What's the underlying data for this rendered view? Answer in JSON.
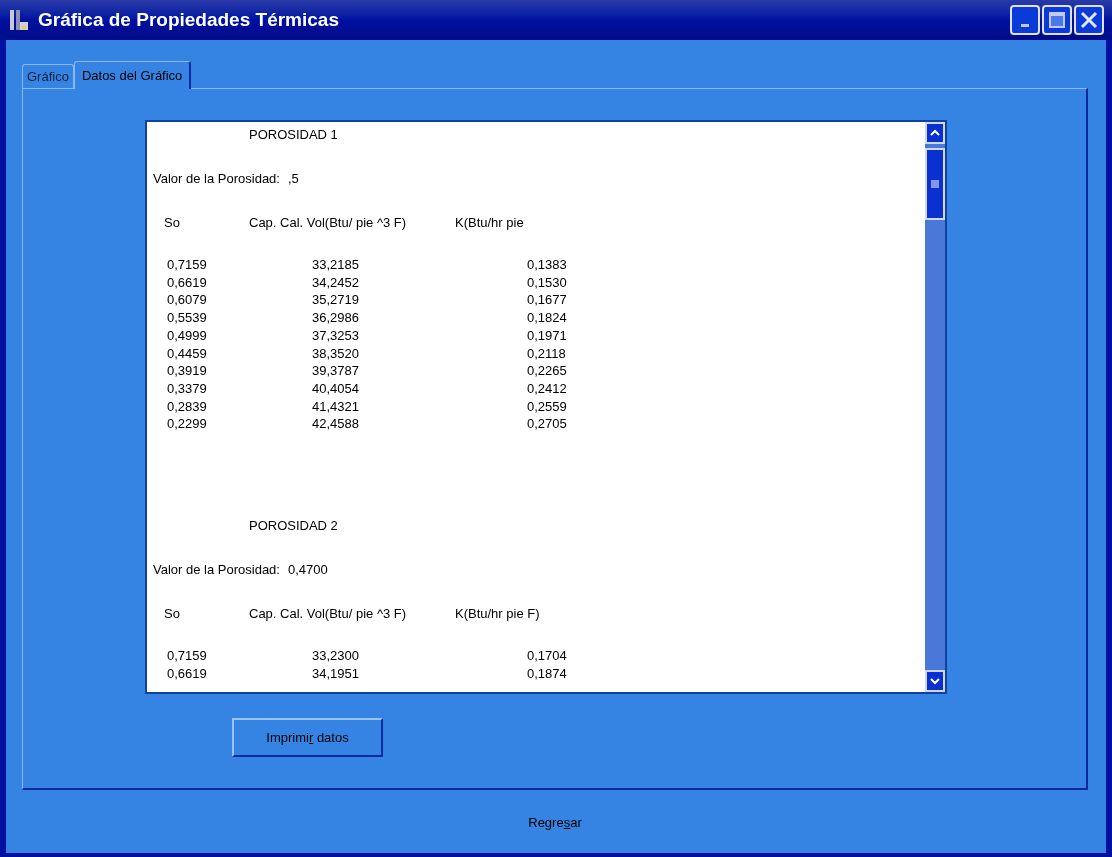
{
  "window": {
    "title": "Gráfica de Propiedades Térmicas"
  },
  "tabs": [
    {
      "label": "Gráfico",
      "selected": false
    },
    {
      "label": "Datos del Gráfico",
      "selected": true
    }
  ],
  "sections": [
    {
      "title": "POROSIDAD 1",
      "value_label": "Valor de la Porosidad:",
      "value": ",5",
      "columns": [
        "So",
        "Cap. Cal. Vol(Btu/ pie ^3 F)",
        "K(Btu/hr pie"
      ],
      "rows": [
        [
          "0,7159",
          "33,2185",
          "0,1383"
        ],
        [
          "0,6619",
          "34,2452",
          "0,1530"
        ],
        [
          "0,6079",
          "35,2719",
          "0,1677"
        ],
        [
          "0,5539",
          "36,2986",
          "0,1824"
        ],
        [
          "0,4999",
          "37,3253",
          "0,1971"
        ],
        [
          "0,4459",
          "38,3520",
          "0,2118"
        ],
        [
          "0,3919",
          "39,3787",
          "0,2265"
        ],
        [
          "0,3379",
          "40,4054",
          "0,2412"
        ],
        [
          "0,2839",
          "41,4321",
          "0,2559"
        ],
        [
          "0,2299",
          "42,4588",
          "0,2705"
        ]
      ]
    },
    {
      "title": "POROSIDAD 2",
      "value_label": "Valor de la Porosidad:",
      "value": "0,4700",
      "columns": [
        "So",
        "Cap. Cal. Vol(Btu/ pie ^3 F)",
        "K(Btu/hr pie F)"
      ],
      "rows": [
        [
          "0,7159",
          "33,2300",
          "0,1704"
        ],
        [
          "0,6619",
          "34,1951",
          "0,1874"
        ]
      ]
    }
  ],
  "print_button": {
    "label_parts": [
      {
        "text": "Imprimi",
        "underline": false
      },
      {
        "text": "r",
        "underline": true
      },
      {
        "text": " datos",
        "underline": false
      }
    ]
  },
  "back_button": {
    "label_parts": [
      {
        "text": "Regre",
        "underline": false
      },
      {
        "text": "s",
        "underline": true
      },
      {
        "text": "ar",
        "underline": false
      }
    ]
  }
}
